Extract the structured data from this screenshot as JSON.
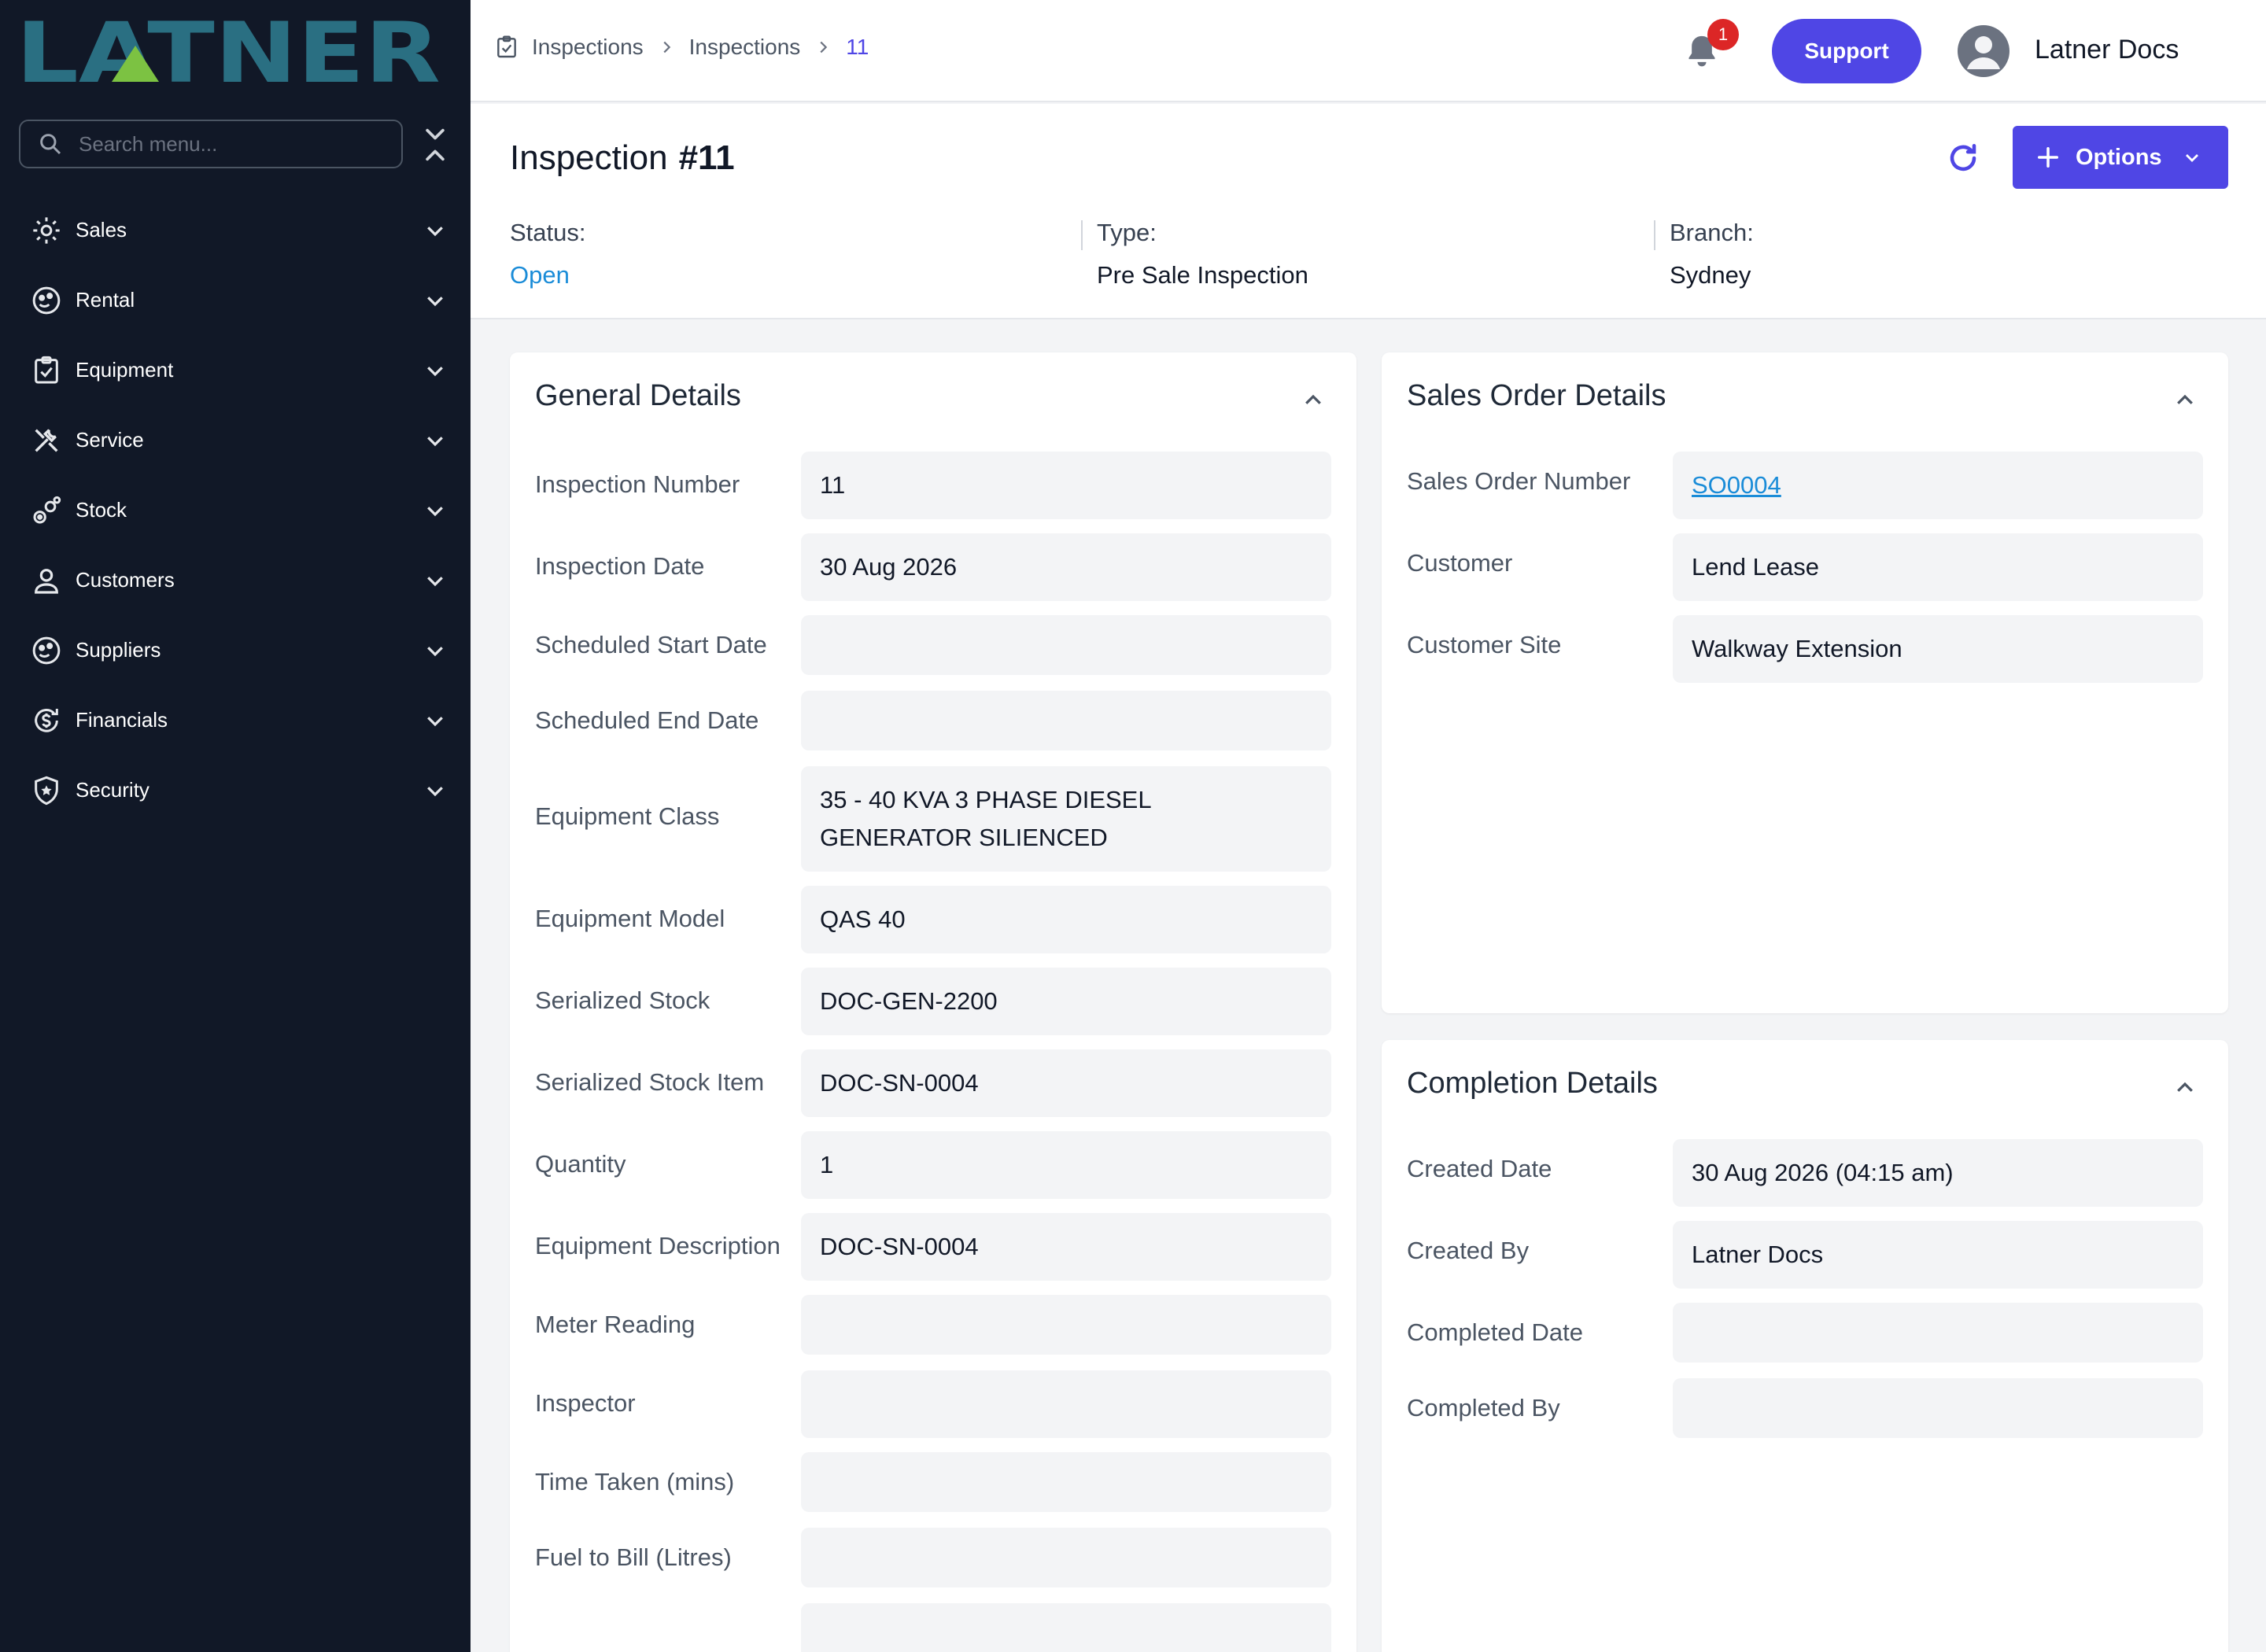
{
  "brand": {
    "logo_text": "LATNER"
  },
  "sidebar": {
    "search_placeholder": "Search menu...",
    "items": [
      {
        "label": "Sales",
        "icon": "sales-icon"
      },
      {
        "label": "Rental",
        "icon": "rental-icon"
      },
      {
        "label": "Equipment",
        "icon": "equipment-icon"
      },
      {
        "label": "Service",
        "icon": "service-icon"
      },
      {
        "label": "Stock",
        "icon": "stock-icon"
      },
      {
        "label": "Customers",
        "icon": "customers-icon"
      },
      {
        "label": "Suppliers",
        "icon": "suppliers-icon"
      },
      {
        "label": "Financials",
        "icon": "financials-icon"
      },
      {
        "label": "Security",
        "icon": "security-icon"
      }
    ]
  },
  "topbar": {
    "breadcrumb": [
      "Inspections",
      "Inspections",
      "11"
    ],
    "notification_count": "1",
    "support_label": "Support",
    "user_name": "Latner Docs"
  },
  "header": {
    "title": "Inspection",
    "number": "#11",
    "options_label": "Options",
    "status_label": "Status:",
    "status_value": "Open",
    "type_label": "Type:",
    "type_value": "Pre Sale Inspection",
    "branch_label": "Branch:",
    "branch_value": "Sydney"
  },
  "general": {
    "title": "General Details",
    "rows": [
      {
        "label": "Inspection Number",
        "value": "11"
      },
      {
        "label": "Inspection Date",
        "value": "30 Aug 2026"
      },
      {
        "label": "Scheduled Start Date",
        "value": ""
      },
      {
        "label": "Scheduled End Date",
        "value": ""
      },
      {
        "label": "Equipment Class",
        "value": "35 - 40 KVA 3 PHASE DIESEL GENERATOR SILIENCED"
      },
      {
        "label": "Equipment Model",
        "value": "QAS 40"
      },
      {
        "label": "Serialized Stock",
        "value": "DOC-GEN-2200"
      },
      {
        "label": "Serialized Stock Item",
        "value": "DOC-SN-0004"
      },
      {
        "label": "Quantity",
        "value": "1"
      },
      {
        "label": "Equipment Description",
        "value": "DOC-SN-0004"
      },
      {
        "label": "Meter Reading",
        "value": ""
      },
      {
        "label": "Inspector",
        "value": ""
      },
      {
        "label": "Time Taken (mins)",
        "value": ""
      },
      {
        "label": "Fuel to Bill (Litres)",
        "value": ""
      },
      {
        "label": "",
        "value": ""
      }
    ]
  },
  "sales_order": {
    "title": "Sales Order Details",
    "rows": [
      {
        "label": "Sales Order Number",
        "value": "SO0004"
      },
      {
        "label": "Customer",
        "value": "Lend Lease"
      },
      {
        "label": "Customer Site",
        "value": "Walkway Extension"
      }
    ]
  },
  "completion": {
    "title": "Completion Details",
    "rows": [
      {
        "label": "Created Date",
        "value": "30 Aug 2026 (04:15 am)"
      },
      {
        "label": "Created By",
        "value": "Latner Docs"
      },
      {
        "label": "Completed Date",
        "value": ""
      },
      {
        "label": "Completed By",
        "value": ""
      }
    ]
  },
  "colors": {
    "sidebar_bg": "#111827",
    "accent": "#4f46e5",
    "link": "#1a8cd8",
    "badge": "#dc2626",
    "logo_teal": "#2a6f82",
    "logo_green": "#7cc242"
  }
}
